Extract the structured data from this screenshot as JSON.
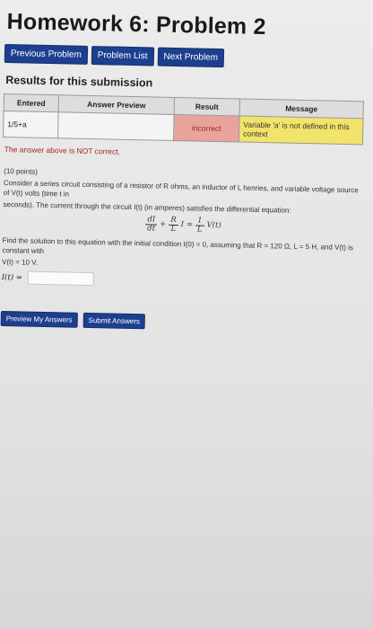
{
  "page": {
    "title": "Homework 6: Problem 2"
  },
  "nav": {
    "previous": "Previous Problem",
    "list": "Problem List",
    "next": "Next Problem"
  },
  "results": {
    "heading": "Results for this submission",
    "columns": [
      "Entered",
      "Answer Preview",
      "Result",
      "Message"
    ],
    "row": {
      "entered": "1/5+a",
      "preview": "",
      "result": "incorrect",
      "message": "Variable 'a' is not defined in this context"
    },
    "colors": {
      "incorrect": "#e8a39d",
      "message": "#f2e36a",
      "notice": "#a4281d"
    }
  },
  "notice": "The answer above is NOT correct.",
  "problem": {
    "points": "(10 points)",
    "line1": "Consider a series circuit consisting of a resistor of R ohms, an inductor of L henries, and variable voltage source of V(t) volts (time t in",
    "line2": "seconds). The current through the circuit I(t) (in amperes) satisfies the differential equation:",
    "eq": {
      "dI": "dI",
      "dt": "dt",
      "plus": "+",
      "R": "R",
      "L1": "L",
      "I": "I",
      "eq": "=",
      "one": "1",
      "L2": "L",
      "V": "V(t)"
    },
    "line3": "Find the solution to this equation with the initial condition I(0) = 0, assuming that R = 120 Ω, L = 5 H, and V(t) is constant with",
    "line4": "V(t) = 10 V.",
    "answer_label": "I(t) ="
  },
  "actions": {
    "preview": "Preview My Answers",
    "submit": "Submit Answers"
  }
}
